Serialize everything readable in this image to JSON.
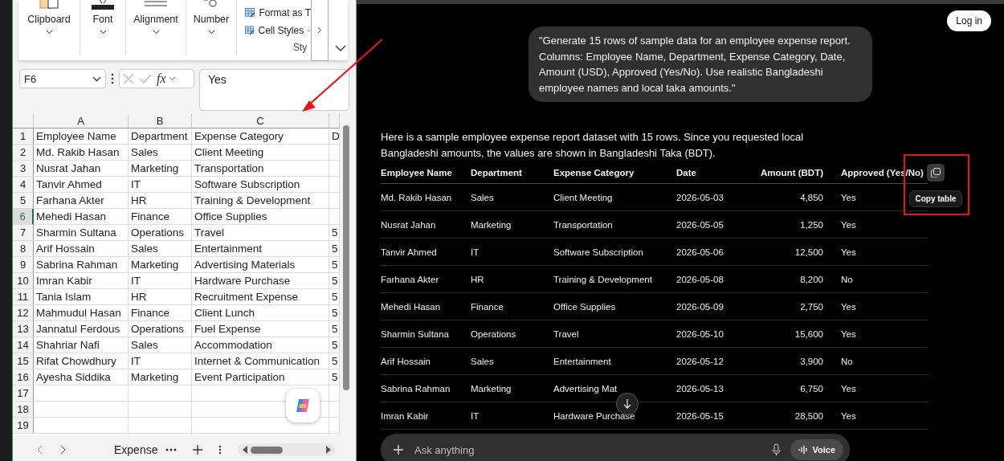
{
  "excel": {
    "ribbon_groups": [
      {
        "kind": "clipboard",
        "label": "Clipboard"
      },
      {
        "kind": "font",
        "label": "Font"
      },
      {
        "kind": "alignment",
        "label": "Alignment"
      },
      {
        "kind": "number",
        "label": "Number"
      }
    ],
    "styles_group": {
      "items": [
        "Format as T",
        "Cell Styles"
      ],
      "label": "Sty"
    },
    "name_box": "F6",
    "function_label": "fx",
    "formula": "Yes",
    "columns": [
      "A",
      "B",
      "C"
    ],
    "rows": [
      {
        "number": "1",
        "selected": false,
        "cells": [
          "Employee Name",
          "Department",
          "Expense Category",
          "D"
        ]
      },
      {
        "number": "2",
        "selected": false,
        "cells": [
          "Md. Rakib Hasan",
          "Sales",
          "Client Meeting",
          ""
        ]
      },
      {
        "number": "3",
        "selected": false,
        "cells": [
          "Nusrat Jahan",
          "Marketing",
          "Transportation",
          ""
        ]
      },
      {
        "number": "4",
        "selected": false,
        "cells": [
          "Tanvir Ahmed",
          "IT",
          "Software Subscription",
          ""
        ]
      },
      {
        "number": "5",
        "selected": false,
        "cells": [
          "Farhana Akter",
          "HR",
          "Training & Development",
          ""
        ]
      },
      {
        "number": "6",
        "selected": true,
        "cells": [
          "Mehedi Hasan",
          "Finance",
          "Office Supplies",
          ""
        ]
      },
      {
        "number": "7",
        "selected": false,
        "cells": [
          "Sharmin Sultana",
          "Operations",
          "Travel",
          "5"
        ]
      },
      {
        "number": "8",
        "selected": false,
        "cells": [
          "Arif Hossain",
          "Sales",
          "Entertainment",
          "5"
        ]
      },
      {
        "number": "9",
        "selected": false,
        "cells": [
          "Sabrina Rahman",
          "Marketing",
          "Advertising Materials",
          "5"
        ]
      },
      {
        "number": "10",
        "selected": false,
        "cells": [
          "Imran Kabir",
          "IT",
          "Hardware Purchase",
          "5"
        ]
      },
      {
        "number": "11",
        "selected": false,
        "cells": [
          "Tania Islam",
          "HR",
          "Recruitment Expense",
          "5"
        ]
      },
      {
        "number": "12",
        "selected": false,
        "cells": [
          "Mahmudul Hasan",
          "Finance",
          "Client Lunch",
          "5"
        ]
      },
      {
        "number": "13",
        "selected": false,
        "cells": [
          "Jannatul Ferdous",
          "Operations",
          "Fuel Expense",
          "5"
        ]
      },
      {
        "number": "14",
        "selected": false,
        "cells": [
          "Shahriar Nafi",
          "Sales",
          "Accommodation",
          "5"
        ]
      },
      {
        "number": "15",
        "selected": false,
        "cells": [
          "Rifat Chowdhury",
          "IT",
          "Internet & Communication",
          "5"
        ]
      },
      {
        "number": "16",
        "selected": false,
        "cells": [
          "Ayesha Siddika",
          "Marketing",
          "Event Participation",
          "5"
        ]
      },
      {
        "number": "17",
        "selected": false,
        "cells": [
          "",
          "",
          "",
          ""
        ]
      },
      {
        "number": "18",
        "selected": false,
        "cells": [
          "",
          "",
          "",
          ""
        ]
      },
      {
        "number": "19",
        "selected": false,
        "cells": [
          "",
          "",
          "",
          ""
        ]
      }
    ],
    "sheet_tab": "Expense"
  },
  "chat": {
    "login": "Log in",
    "user_message": "\"Generate 15 rows of sample data for an employee expense report. Columns: Employee Name, Department, Expense Category, Date, Amount (USD), Approved (Yes/No). Use realistic Bangladeshi employee names and local taka amounts.\"",
    "reply": "Here is a sample employee expense report dataset with 15 rows. Since you requested local Bangladeshi amounts, the values are shown in Bangladeshi Taka (BDT).",
    "table": {
      "columns": [
        "Employee Name",
        "Department",
        "Expense Category",
        "Date",
        "Amount (BDT)",
        "Approved (Yes/No)"
      ],
      "rows": [
        [
          "Md. Rakib Hasan",
          "Sales",
          "Client Meeting",
          "2026-05-03",
          "4,850",
          "Yes"
        ],
        [
          "Nusrat Jahan",
          "Marketing",
          "Transportation",
          "2026-05-05",
          "1,250",
          "Yes"
        ],
        [
          "Tanvir Ahmed",
          "IT",
          "Software Subscription",
          "2026-05-06",
          "12,500",
          "Yes"
        ],
        [
          "Farhana Akter",
          "HR",
          "Training & Development",
          "2026-05-08",
          "8,200",
          "No"
        ],
        [
          "Mehedi Hasan",
          "Finance",
          "Office Supplies",
          "2026-05-09",
          "2,750",
          "Yes"
        ],
        [
          "Sharmin Sultana",
          "Operations",
          "Travel",
          "2026-05-10",
          "15,600",
          "Yes"
        ],
        [
          "Arif Hossain",
          "Sales",
          "Entertainment",
          "2026-05-12",
          "3,900",
          "No"
        ],
        [
          "Sabrina Rahman",
          "Marketing",
          "Advertising Mat",
          "2026-05-13",
          "6,750",
          "Yes"
        ],
        [
          "Imran Kabir",
          "IT",
          "Hardware Purchase",
          "2026-05-15",
          "28,500",
          "Yes"
        ]
      ]
    },
    "copy_tooltip": "Copy table",
    "input_placeholder": "Ask anything",
    "voice": "Voice"
  }
}
